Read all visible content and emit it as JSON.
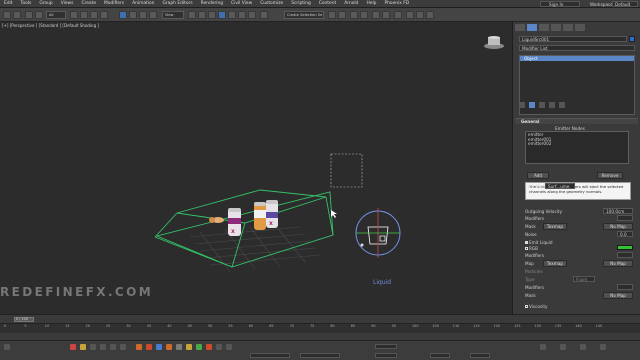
{
  "menubar": {
    "items": [
      "Edit",
      "Tools",
      "Group",
      "Views",
      "Create",
      "Modifiers",
      "Animation",
      "Graph Editors",
      "Rendering",
      "Civil View",
      "Customize",
      "Scripting",
      "Content",
      "Arnold",
      "Help",
      "Phoenix FD"
    ],
    "sign_in": "Sign In",
    "workspaces_label": "Workspaces:",
    "workspaces_value": "Default"
  },
  "toolbar": {
    "filter_value": "All",
    "view_value": "View",
    "selection_set_value": "Create Selection Se"
  },
  "viewport": {
    "label": "[+] [Perspective ] [Standard ] [Default Shading ]",
    "watermark": "REDEFINEFX.COM",
    "object_label": "Liquid"
  },
  "command_panel": {
    "object_name": "LiquidSrc001",
    "modifier_list": "Modifier List",
    "stack_items": [
      "Object"
    ],
    "general_title": "General",
    "emitter_nodes_title": "Emitter Nodes",
    "emitters": [
      "emitter",
      "emitter001",
      "emitter002"
    ],
    "add_label": "Add",
    "remove_label": "Remove",
    "tooltip_text": "The surface of the emitters will eject the selected channels along the geometry normals.",
    "emit_mode_label": "Emit Mode",
    "emit_mode_value": "Surf...ume",
    "outgoing_velocity_label": "Outgoing Velocity",
    "outgoing_velocity_value": "100.0cm",
    "modifiers_label": "Modifiers",
    "mask_label": "Mask",
    "texmap_label": "Texmap",
    "no_map_label": "No Map",
    "noise_label": "Noise",
    "noise_value": "0.0",
    "emit_liquid_label": "Emit Liquid",
    "rgb_label": "RGB",
    "map_label": "Map",
    "particles_label": "Particles",
    "type_label": "Type",
    "type_value": "Foam",
    "viscosity_label": "Viscosity"
  },
  "timeline": {
    "slider_label": "0 / 100",
    "ticks": [
      "0",
      "5",
      "10",
      "15",
      "20",
      "25",
      "30",
      "35",
      "40",
      "45",
      "50",
      "55",
      "60",
      "65",
      "70",
      "75",
      "80",
      "85",
      "90",
      "95",
      "100",
      "105",
      "110",
      "115",
      "120",
      "125",
      "130",
      "135",
      "140",
      "145"
    ]
  },
  "colors": {
    "accent": "#5b87c8",
    "bounding_box": "#35c26a",
    "rgb_swatch": "#33c233",
    "liquid_label": "#6f8fe0"
  }
}
